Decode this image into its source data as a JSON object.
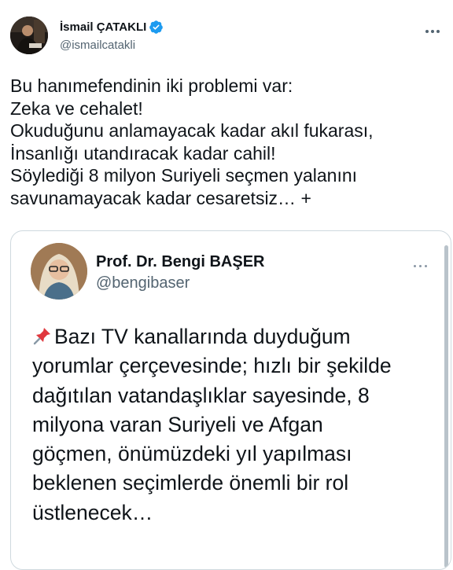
{
  "author": {
    "display_name": "İsmail ÇATAKLI",
    "handle": "@ismailcatakli",
    "verified": true,
    "avatar_icon": "profile-photo"
  },
  "tweet": {
    "lines": [
      "Bu hanımefendinin iki problemi var:",
      "Zeka ve cehalet!",
      "Okuduğunu anlamayacak kadar akıl fukarası,",
      "İnsanlığı utandıracak kadar cahil!",
      "Söylediği 8 milyon Suriyeli seçmen yalanını",
      "savunamayacak kadar cesaretsiz… +"
    ]
  },
  "quoted": {
    "display_name": "Prof. Dr. Bengi BAŞER",
    "handle": "@bengibaser",
    "lines": [
      "Bazı TV kanallarında duyduğum",
      "yorumlar çerçevesinde; hızlı bir şekilde",
      "dağıtılan vatandaşlıklar sayesinde, 8",
      "milyona varan Suriyeli ve Afgan",
      "göçmen, önümüzdeki yıl yapılması",
      "beklenen seçimlerde önemli bir rol",
      "üstlenecek…"
    ],
    "pin_icon": "pushpin-emoji"
  },
  "colors": {
    "text": "#0f1419",
    "secondary": "#536471",
    "verified": "#1d9bf0",
    "border": "#cfd9de"
  }
}
